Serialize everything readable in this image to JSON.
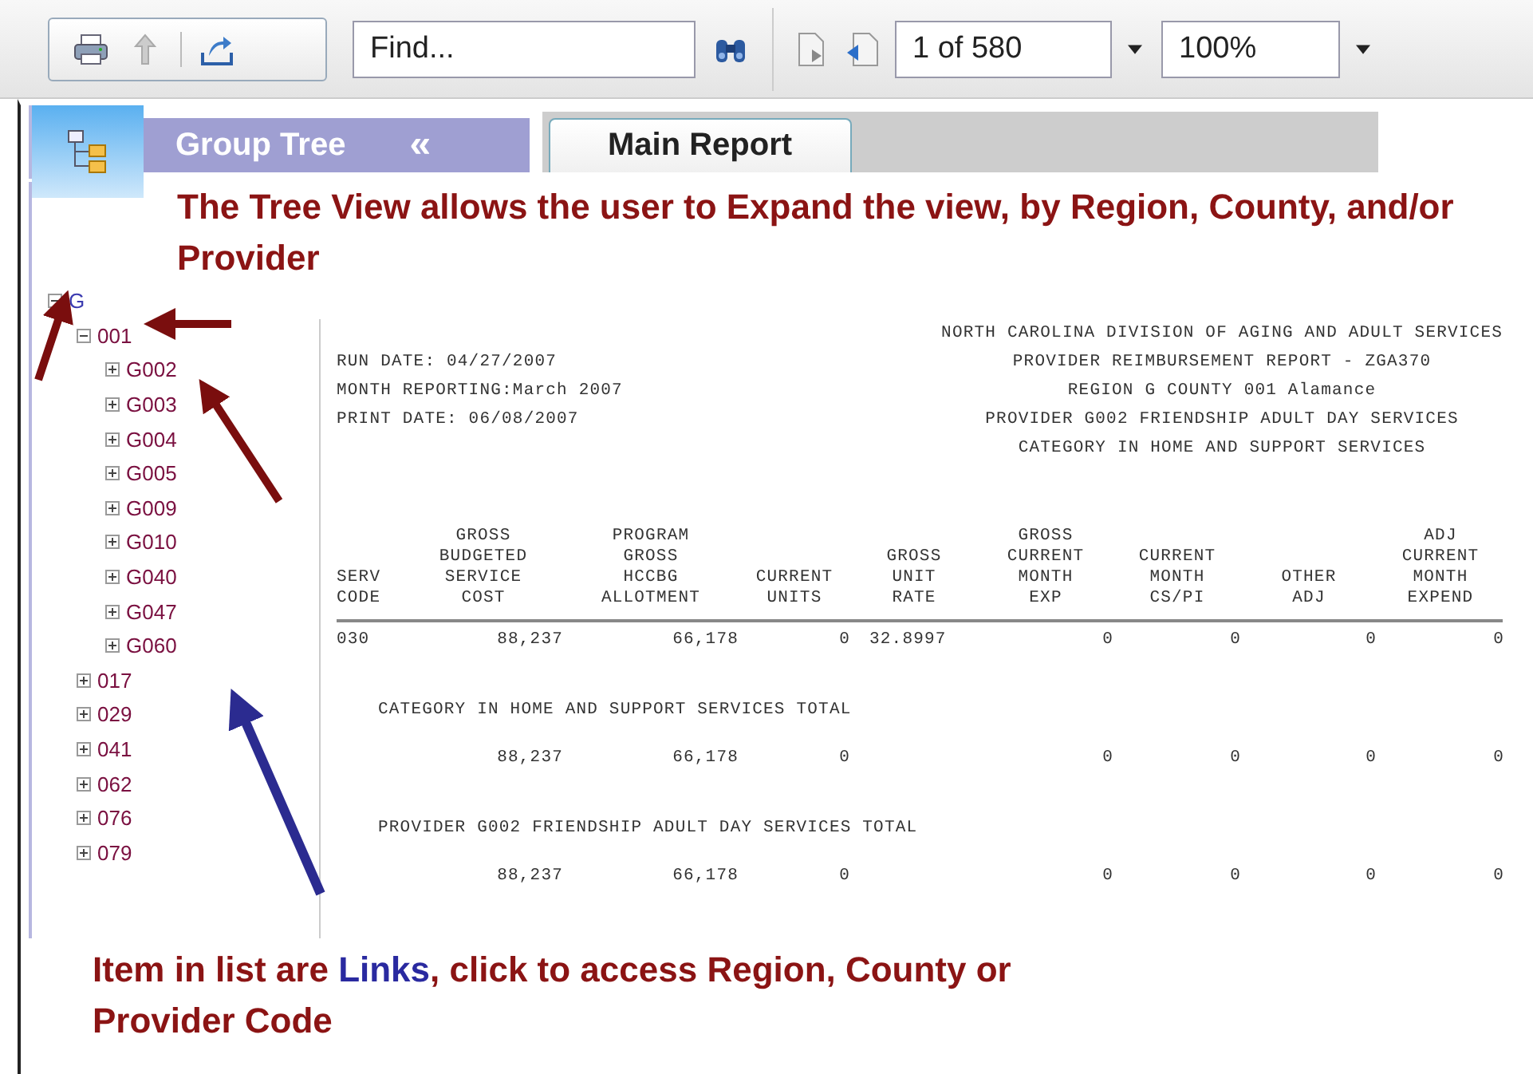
{
  "toolbar": {
    "find": {
      "placeholder": "Find..."
    },
    "page": "1 of 580",
    "zoom": "100%"
  },
  "panel": {
    "title": "Group Tree",
    "collapse": "«"
  },
  "tabs": [
    {
      "label": "Main Report",
      "selected": true
    }
  ],
  "tree": [
    {
      "label": "G",
      "expanded": true,
      "children": [
        {
          "label": "001",
          "expanded": true,
          "children": [
            {
              "label": "G002",
              "expanded": false
            },
            {
              "label": "G003",
              "expanded": false
            },
            {
              "label": "G004",
              "expanded": false
            },
            {
              "label": "G005",
              "expanded": false
            },
            {
              "label": "G009",
              "expanded": false
            },
            {
              "label": "G010",
              "expanded": false
            },
            {
              "label": "G040",
              "expanded": false
            },
            {
              "label": "G047",
              "expanded": false
            },
            {
              "label": "G060",
              "expanded": false
            }
          ]
        },
        {
          "label": "017",
          "expanded": false
        },
        {
          "label": "029",
          "expanded": false
        },
        {
          "label": "041",
          "expanded": false
        },
        {
          "label": "062",
          "expanded": false
        },
        {
          "label": "076",
          "expanded": false
        },
        {
          "label": "079",
          "expanded": false
        }
      ]
    }
  ],
  "report": {
    "header_left": [
      "RUN DATE: 04/27/2007",
      "MONTH REPORTING:March 2007",
      "PRINT DATE: 06/08/2007"
    ],
    "header_right": [
      "NORTH CAROLINA DIVISION OF AGING AND ADULT SERVICES",
      "PROVIDER REIMBURSEMENT REPORT - ZGA370",
      "REGION G COUNTY 001 Alamance",
      "PROVIDER G002 FRIENDSHIP ADULT DAY SERVICES",
      "CATEGORY IN HOME AND SUPPORT SERVICES"
    ],
    "columns": [
      [
        "SERV",
        "CODE"
      ],
      [
        "GROSS",
        "BUDGETED",
        "SERVICE",
        "COST"
      ],
      [
        "PROGRAM",
        "GROSS",
        "HCCBG",
        "ALLOTMENT"
      ],
      [
        "CURRENT",
        "UNITS"
      ],
      [
        "GROSS",
        "UNIT",
        "RATE"
      ],
      [
        "GROSS",
        "CURRENT",
        "MONTH",
        "EXP"
      ],
      [
        "CURRENT",
        "MONTH",
        "CS/PI"
      ],
      [
        "OTHER",
        "ADJ"
      ],
      [
        "ADJ",
        "CURRENT",
        "MONTH",
        "EXPEND"
      ]
    ],
    "rows": [
      {
        "kind": "values",
        "cells": [
          "030",
          "88,237",
          "66,178",
          "0",
          "32.8997",
          "0",
          "0",
          "0",
          "0"
        ]
      },
      {
        "kind": "caption",
        "text": "CATEGORY IN HOME AND SUPPORT SERVICES TOTAL"
      },
      {
        "kind": "values",
        "cells": [
          null,
          "88,237",
          "66,178",
          "0",
          null,
          "0",
          "0",
          "0",
          "0"
        ]
      },
      {
        "kind": "caption",
        "text": "PROVIDER G002 FRIENDSHIP ADULT DAY SERVICES TOTAL"
      },
      {
        "kind": "values",
        "cells": [
          null,
          "88,237",
          "66,178",
          "0",
          null,
          "0",
          "0",
          "0",
          "0"
        ]
      }
    ]
  },
  "notes": {
    "top": "The Tree View allows the user to Expand the view, by Region, County, and/or Provider",
    "bottom": {
      "before": "Item in list are ",
      "highlight": "Links",
      "after": ", click to access Region, County or Provider Code"
    }
  }
}
